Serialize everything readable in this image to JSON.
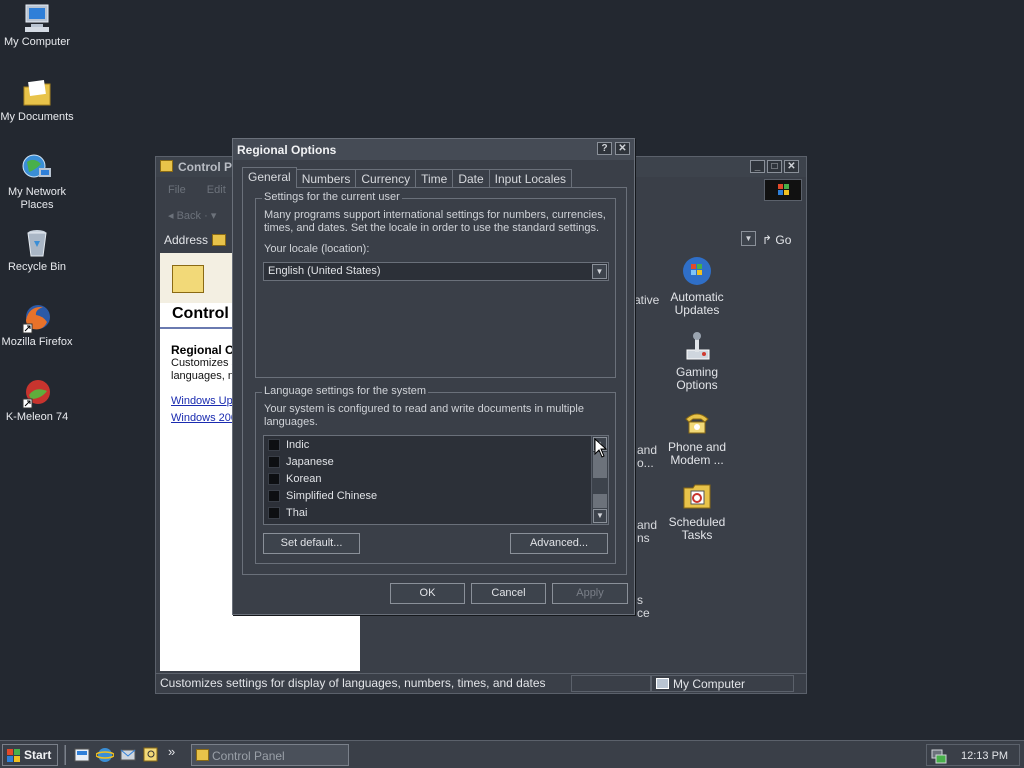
{
  "desktop": {
    "icons": [
      {
        "label": "My Computer",
        "icon": "my-computer-icon"
      },
      {
        "label": "My Documents",
        "icon": "my-documents-icon"
      },
      {
        "label": "My Network Places",
        "icon": "network-places-icon"
      },
      {
        "label": "Recycle Bin",
        "icon": "recycle-bin-icon"
      },
      {
        "label": "Mozilla Firefox",
        "icon": "firefox-icon"
      },
      {
        "label": "K-Meleon 74",
        "icon": "kmeleon-icon"
      }
    ]
  },
  "control_panel": {
    "title": "Control Pa",
    "menu": [
      "File",
      "Edit"
    ],
    "toolbar_back": "Back",
    "address_label": "Address",
    "go_label": "Go",
    "header_title": "Control",
    "section_title": "Regional O",
    "section_desc_1": "Customizes s",
    "section_desc_2": "languages, n",
    "link_1": "Windows Upd",
    "link_2": "Windows 200",
    "icons": [
      {
        "label": "Automatic Updates"
      },
      {
        "label": "Gaming Options"
      },
      {
        "label": "Phone and Modem ..."
      },
      {
        "label": "Scheduled Tasks"
      }
    ],
    "partial_labels": [
      "ative",
      "and",
      "o...",
      "and",
      "ns",
      "s",
      "ce"
    ],
    "status_text": "Customizes settings for display of languages, numbers, times, and dates",
    "status_zone": "My Computer"
  },
  "dialog": {
    "title": "Regional Options",
    "help_btn": "?",
    "close_btn": "✕",
    "tabs": [
      "General",
      "Numbers",
      "Currency",
      "Time",
      "Date",
      "Input Locales"
    ],
    "user_group": {
      "legend": "Settings for the current user",
      "desc_1": "Many programs support international settings for numbers, currencies,",
      "desc_2": "times, and dates. Set the locale in order to use the standard settings.",
      "locale_label": "Your locale (location):",
      "locale_value": "English (United States)"
    },
    "system_group": {
      "legend": "Language settings for the system",
      "desc_1": "Your system is configured to read and write documents in multiple",
      "desc_2": "languages.",
      "languages": [
        "Indic",
        "Japanese",
        "Korean",
        "Simplified Chinese",
        "Thai"
      ],
      "set_default": "Set default...",
      "advanced": "Advanced..."
    },
    "ok": "OK",
    "cancel": "Cancel",
    "apply": "Apply"
  },
  "taskbar": {
    "start": "Start",
    "quick_launch_more": "»",
    "task_label": "Control Panel",
    "clock": "12:13 PM"
  }
}
